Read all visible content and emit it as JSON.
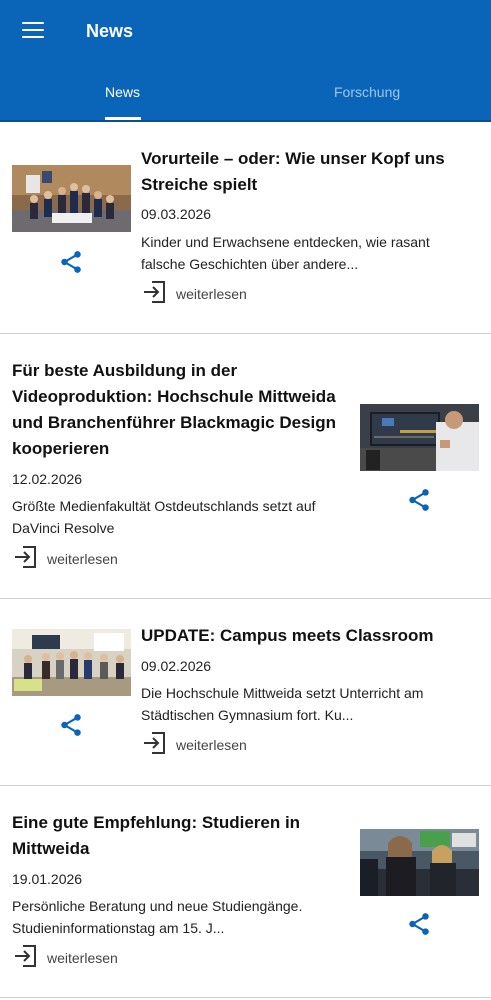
{
  "appbar": {
    "title": "News",
    "menu_icon": "hamburger-menu-icon",
    "background": "#0a64b8"
  },
  "tabs": [
    {
      "label": "News",
      "active": true
    },
    {
      "label": "Forschung",
      "active": false
    }
  ],
  "articles": [
    {
      "title": "Vorurteile – oder: Wie unser Kopf uns Streiche spielt",
      "date": "09.03.2026",
      "teaser": "Kinder und Erwachsene entdecken, wie rasant falsche Geschichten über andere...",
      "more_label": "weiterlesen",
      "image_side": "left"
    },
    {
      "title": "Für beste Ausbildung in der Videoproduktion: Hochschule Mittweida und Branchenführer Blackmagic Design kooperieren",
      "date": "12.02.2026",
      "teaser": "Größte Medienfakultät Ostdeutschlands setzt auf DaVinci Resolve",
      "more_label": "weiterlesen",
      "image_side": "right"
    },
    {
      "title": "UPDATE: Campus meets Classroom",
      "date": "09.02.2026",
      "teaser": "Die Hochschule Mittweida setzt Unterricht am Städtischen Gymnasium fort. Ku...",
      "more_label": "weiterlesen",
      "image_side": "left"
    },
    {
      "title": "Eine gute Empfehlung: Studieren in Mittweida",
      "date": "19.01.2026",
      "teaser": "Persönliche Beratung und neue Studiengänge. Studieninformationstag am 15. J...",
      "more_label": "weiterlesen",
      "image_side": "right"
    }
  ],
  "icons": {
    "share": "share-icon",
    "more": "login-arrow-icon"
  },
  "colors": {
    "primary": "#0a64b8",
    "share": "#0a64b8",
    "tab_inactive": "#9ec5ea"
  }
}
